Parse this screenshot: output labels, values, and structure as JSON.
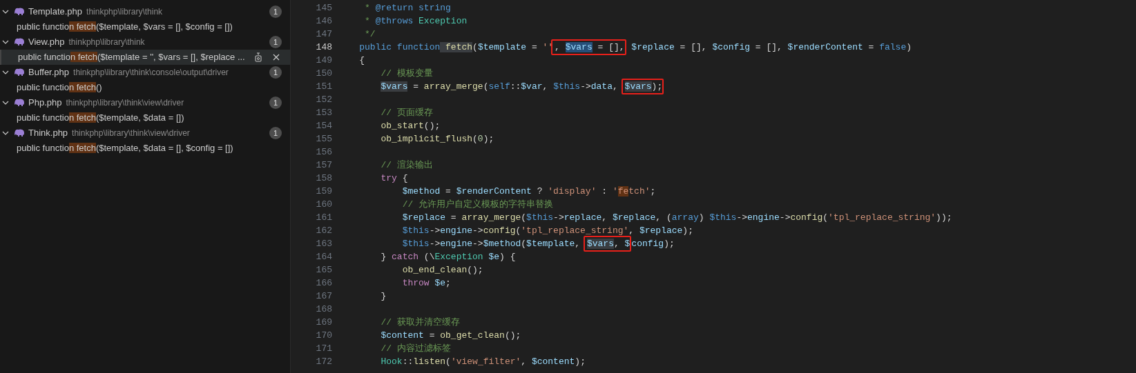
{
  "search_results": [
    {
      "file": "Template.php",
      "path": "thinkphp\\library\\think",
      "count": "1",
      "expanded": true,
      "matches": [
        {
          "selected": false,
          "before": "public functio",
          "match": "n fetch",
          "after": "($template, $vars = [], $config = [])"
        }
      ]
    },
    {
      "file": "View.php",
      "path": "thinkphp\\library\\think",
      "count": "1",
      "expanded": true,
      "matches": [
        {
          "selected": true,
          "before": "public functio",
          "match": "n fetch",
          "after": "($template = '', $vars = [], $replace ..."
        }
      ]
    },
    {
      "file": "Buffer.php",
      "path": "thinkphp\\library\\think\\console\\output\\driver",
      "count": "1",
      "expanded": true,
      "matches": [
        {
          "selected": false,
          "before": "public functio",
          "match": "n fetch",
          "after": "()"
        }
      ]
    },
    {
      "file": "Php.php",
      "path": "thinkphp\\library\\think\\view\\driver",
      "count": "1",
      "expanded": true,
      "matches": [
        {
          "selected": false,
          "before": "public functio",
          "match": "n fetch",
          "after": "($template, $data = [])"
        }
      ]
    },
    {
      "file": "Think.php",
      "path": "thinkphp\\library\\think\\view\\driver",
      "count": "1",
      "expanded": true,
      "matches": [
        {
          "selected": false,
          "before": "public functio",
          "match": "n fetch",
          "after": "($template, $data = [], $config = [])"
        }
      ]
    }
  ],
  "editor": {
    "lines": [
      {
        "number": "145",
        "current": false,
        "tokens": [
          {
            "text": "     * ",
            "kind": "comment"
          },
          {
            "text": "@return",
            "kind": "keyword"
          },
          {
            "text": " string",
            "kind": "keyword"
          }
        ]
      },
      {
        "number": "146",
        "current": false,
        "tokens": [
          {
            "text": "     * ",
            "kind": "comment"
          },
          {
            "text": "@throws",
            "kind": "keyword"
          },
          {
            "text": " Exception",
            "kind": "type"
          }
        ]
      },
      {
        "number": "147",
        "current": false,
        "tokens": [
          {
            "text": "     */",
            "kind": "comment"
          }
        ]
      },
      {
        "number": "148",
        "current": true,
        "tokens": [
          {
            "text": "    public",
            "kind": "keyword"
          },
          {
            "text": " function",
            "kind": "keyword"
          },
          {
            "text": " fetch",
            "kind": "function",
            "highlighted": true
          },
          {
            "text": "(",
            "kind": "plain"
          },
          {
            "text": "$template",
            "kind": "variable"
          },
          {
            "text": " = ",
            "kind": "plain"
          },
          {
            "text": "''",
            "kind": "string"
          },
          {
            "kind": "box",
            "children": [
              {
                "text": ", ",
                "kind": "plain"
              },
              {
                "text": "$vars",
                "kind": "variable",
                "selected": true
              },
              {
                "text": " = [],",
                "kind": "plain"
              }
            ]
          },
          {
            "text": " $replace",
            "kind": "variable"
          },
          {
            "text": " = [], ",
            "kind": "plain"
          },
          {
            "text": "$config",
            "kind": "variable"
          },
          {
            "text": " = [], ",
            "kind": "plain"
          },
          {
            "text": "$renderContent",
            "kind": "variable"
          },
          {
            "text": " = ",
            "kind": "plain"
          },
          {
            "text": "false",
            "kind": "keyword"
          },
          {
            "text": ")",
            "kind": "plain"
          }
        ]
      },
      {
        "number": "149",
        "current": false,
        "tokens": [
          {
            "text": "    {",
            "kind": "plain"
          }
        ]
      },
      {
        "number": "150",
        "current": false,
        "tokens": [
          {
            "text": "        // 模板变量",
            "kind": "comment"
          }
        ]
      },
      {
        "number": "151",
        "current": false,
        "tokens": [
          {
            "text": "        $vars",
            "kind": "variable",
            "highlighted": true
          },
          {
            "text": " = ",
            "kind": "plain"
          },
          {
            "text": "array_merge",
            "kind": "function"
          },
          {
            "text": "(",
            "kind": "plain"
          },
          {
            "text": "self",
            "kind": "keyword"
          },
          {
            "text": "::",
            "kind": "plain"
          },
          {
            "text": "$var",
            "kind": "variable"
          },
          {
            "text": ", ",
            "kind": "plain"
          },
          {
            "text": "$this",
            "kind": "keyword"
          },
          {
            "text": "->",
            "kind": "plain"
          },
          {
            "text": "data",
            "kind": "variable"
          },
          {
            "text": ", ",
            "kind": "plain"
          },
          {
            "kind": "box",
            "children": [
              {
                "text": "$vars",
                "kind": "variable",
                "highlighted": true
              },
              {
                "text": ");",
                "kind": "plain"
              }
            ]
          }
        ]
      },
      {
        "number": "152",
        "current": false
      },
      {
        "number": "153",
        "current": false,
        "tokens": [
          {
            "text": "        // 页面缓存",
            "kind": "comment"
          }
        ]
      },
      {
        "number": "154",
        "current": false,
        "tokens": [
          {
            "text": "        ob_start",
            "kind": "function"
          },
          {
            "text": "();",
            "kind": "plain"
          }
        ]
      },
      {
        "number": "155",
        "current": false,
        "tokens": [
          {
            "text": "        ob_implicit_flush",
            "kind": "function"
          },
          {
            "text": "(",
            "kind": "plain"
          },
          {
            "text": "0",
            "kind": "number"
          },
          {
            "text": ");",
            "kind": "plain"
          }
        ]
      },
      {
        "number": "156",
        "current": false
      },
      {
        "number": "157",
        "current": false,
        "tokens": [
          {
            "text": "        // 渲染输出",
            "kind": "comment"
          }
        ]
      },
      {
        "number": "158",
        "current": false,
        "tokens": [
          {
            "text": "        try",
            "kind": "control"
          },
          {
            "text": " {",
            "kind": "plain"
          }
        ]
      },
      {
        "number": "159",
        "current": false,
        "tokens": [
          {
            "text": "            $method",
            "kind": "variable"
          },
          {
            "text": " = ",
            "kind": "plain"
          },
          {
            "text": "$renderContent",
            "kind": "variable"
          },
          {
            "text": " ? ",
            "kind": "plain"
          },
          {
            "text": "'display'",
            "kind": "string"
          },
          {
            "text": " : ",
            "kind": "plain"
          },
          {
            "text": "'",
            "kind": "string"
          },
          {
            "text": "fe",
            "kind": "string",
            "search_match": true
          },
          {
            "text": "tch'",
            "kind": "string"
          },
          {
            "text": ";",
            "kind": "plain"
          }
        ]
      },
      {
        "number": "160",
        "current": false,
        "tokens": [
          {
            "text": "            // 允许用户自定义模板的字符串替换",
            "kind": "comment"
          }
        ]
      },
      {
        "number": "161",
        "current": false,
        "tokens": [
          {
            "text": "            $replace",
            "kind": "variable"
          },
          {
            "text": " = ",
            "kind": "plain"
          },
          {
            "text": "array_merge",
            "kind": "function"
          },
          {
            "text": "(",
            "kind": "plain"
          },
          {
            "text": "$this",
            "kind": "keyword"
          },
          {
            "text": "->",
            "kind": "plain"
          },
          {
            "text": "replace",
            "kind": "variable"
          },
          {
            "text": ", ",
            "kind": "plain"
          },
          {
            "text": "$replace",
            "kind": "variable"
          },
          {
            "text": ", (",
            "kind": "plain"
          },
          {
            "text": "array",
            "kind": "keyword"
          },
          {
            "text": ") ",
            "kind": "plain"
          },
          {
            "text": "$this",
            "kind": "keyword"
          },
          {
            "text": "->",
            "kind": "plain"
          },
          {
            "text": "engine",
            "kind": "variable"
          },
          {
            "text": "->",
            "kind": "plain"
          },
          {
            "text": "config",
            "kind": "function"
          },
          {
            "text": "(",
            "kind": "plain"
          },
          {
            "text": "'tpl_replace_string'",
            "kind": "string"
          },
          {
            "text": "));",
            "kind": "plain"
          }
        ]
      },
      {
        "number": "162",
        "current": false,
        "tokens": [
          {
            "text": "            $this",
            "kind": "keyword"
          },
          {
            "text": "->",
            "kind": "plain"
          },
          {
            "text": "engine",
            "kind": "variable"
          },
          {
            "text": "->",
            "kind": "plain"
          },
          {
            "text": "config",
            "kind": "function"
          },
          {
            "text": "(",
            "kind": "plain"
          },
          {
            "text": "'tpl_replace_string'",
            "kind": "string"
          },
          {
            "text": ", ",
            "kind": "plain"
          },
          {
            "text": "$replace",
            "kind": "variable"
          },
          {
            "text": ");",
            "kind": "plain"
          }
        ]
      },
      {
        "number": "163",
        "current": false,
        "tokens": [
          {
            "text": "            $this",
            "kind": "keyword"
          },
          {
            "text": "->",
            "kind": "plain"
          },
          {
            "text": "engine",
            "kind": "variable"
          },
          {
            "text": "->",
            "kind": "plain"
          },
          {
            "text": "$method",
            "kind": "variable"
          },
          {
            "text": "(",
            "kind": "plain"
          },
          {
            "text": "$template",
            "kind": "variable"
          },
          {
            "text": ", ",
            "kind": "plain"
          },
          {
            "kind": "box",
            "children": [
              {
                "text": "$vars",
                "kind": "variable",
                "highlighted": true
              },
              {
                "text": ", ",
                "kind": "plain"
              },
              {
                "text": "$",
                "kind": "variable"
              }
            ]
          },
          {
            "text": "config",
            "kind": "variable"
          },
          {
            "text": ");",
            "kind": "plain"
          }
        ]
      },
      {
        "number": "164",
        "current": false,
        "tokens": [
          {
            "text": "        } ",
            "kind": "plain"
          },
          {
            "text": "catch",
            "kind": "control"
          },
          {
            "text": " (\\",
            "kind": "plain"
          },
          {
            "text": "Exception",
            "kind": "type"
          },
          {
            "text": " $e",
            "kind": "variable"
          },
          {
            "text": ") {",
            "kind": "plain"
          }
        ]
      },
      {
        "number": "165",
        "current": false,
        "tokens": [
          {
            "text": "            ob_end_clean",
            "kind": "function"
          },
          {
            "text": "();",
            "kind": "plain"
          }
        ]
      },
      {
        "number": "166",
        "current": false,
        "tokens": [
          {
            "text": "            throw",
            "kind": "control"
          },
          {
            "text": " $e",
            "kind": "variable"
          },
          {
            "text": ";",
            "kind": "plain"
          }
        ]
      },
      {
        "number": "167",
        "current": false,
        "tokens": [
          {
            "text": "        }",
            "kind": "plain"
          }
        ]
      },
      {
        "number": "168",
        "current": false
      },
      {
        "number": "169",
        "current": false,
        "tokens": [
          {
            "text": "        // 获取并清空缓存",
            "kind": "comment"
          }
        ]
      },
      {
        "number": "170",
        "current": false,
        "tokens": [
          {
            "text": "        $content",
            "kind": "variable"
          },
          {
            "text": " = ",
            "kind": "plain"
          },
          {
            "text": "ob_get_clean",
            "kind": "function"
          },
          {
            "text": "();",
            "kind": "plain"
          }
        ]
      },
      {
        "number": "171",
        "current": false,
        "tokens": [
          {
            "text": "        // 内容过滤标签",
            "kind": "comment"
          }
        ]
      },
      {
        "number": "172",
        "current": false,
        "tokens": [
          {
            "text": "        Hook",
            "kind": "type"
          },
          {
            "text": "::",
            "kind": "plain"
          },
          {
            "text": "listen",
            "kind": "function"
          },
          {
            "text": "(",
            "kind": "plain"
          },
          {
            "text": "'view_filter'",
            "kind": "string"
          },
          {
            "text": ", ",
            "kind": "plain"
          },
          {
            "text": "$content",
            "kind": "variable"
          },
          {
            "text": ");",
            "kind": "plain"
          }
        ]
      }
    ]
  }
}
